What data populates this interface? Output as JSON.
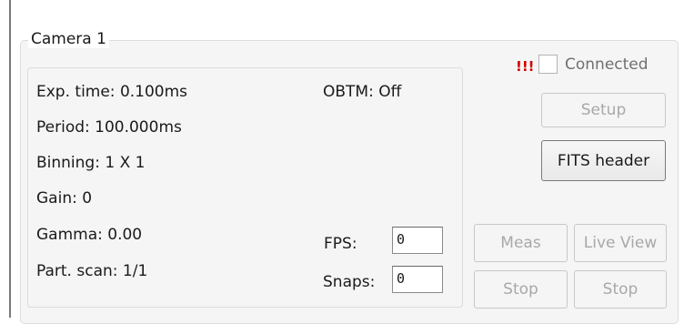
{
  "group": {
    "title": "Camera 1"
  },
  "params": {
    "exp_time": "Exp. time: 0.100ms",
    "period": "Period: 100.000ms",
    "binning": "Binning: 1 X 1",
    "gain": "Gain: 0",
    "gamma": "Gamma: 0.00",
    "part_scan": "Part. scan: 1/1",
    "obtm": "OBTM: Off"
  },
  "fps": {
    "label": "FPS:",
    "value": "0"
  },
  "snaps": {
    "label": "Snaps:",
    "value": "0"
  },
  "status": {
    "warning": "!!!",
    "warning_color": "#d00000",
    "connected_label": "Connected",
    "connected_checked": false
  },
  "buttons": {
    "setup": "Setup",
    "fits_header": "FITS header",
    "meas": "Meas",
    "live_view": "Live View",
    "stop_meas": "Stop",
    "stop_live": "Stop"
  }
}
